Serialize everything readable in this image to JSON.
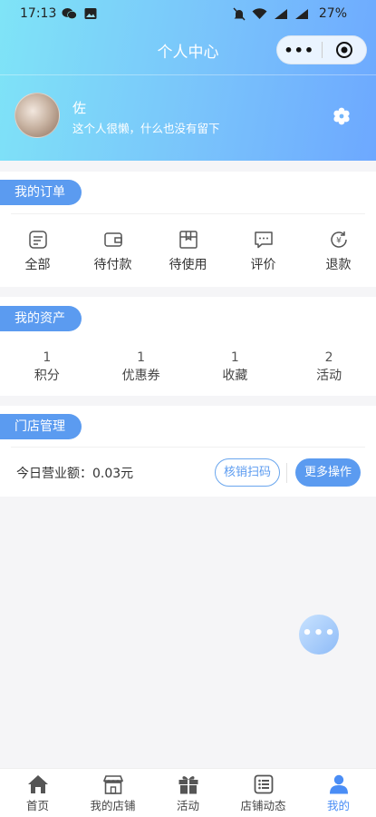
{
  "status_bar": {
    "time": "17:13",
    "battery": "27%"
  },
  "nav": {
    "title": "个人中心"
  },
  "profile": {
    "name": "佐",
    "signature": "这个人很懒，什么也没有留下"
  },
  "orders": {
    "title": "我的订单",
    "items": [
      {
        "label": "全部",
        "icon": "document-icon"
      },
      {
        "label": "待付款",
        "icon": "wallet-icon"
      },
      {
        "label": "待使用",
        "icon": "box-icon"
      },
      {
        "label": "评价",
        "icon": "comment-icon"
      },
      {
        "label": "退款",
        "icon": "refund-icon"
      }
    ]
  },
  "assets": {
    "title": "我的资产",
    "items": [
      {
        "count": "1",
        "label": "积分"
      },
      {
        "count": "1",
        "label": "优惠券"
      },
      {
        "count": "1",
        "label": "收藏"
      },
      {
        "count": "2",
        "label": "活动"
      }
    ]
  },
  "store": {
    "title": "门店管理",
    "today_label": "今日营业额：0.03元",
    "scan_button": "核销扫码",
    "more_button": "更多操作"
  },
  "fab": {
    "icon": "more-dots-icon"
  },
  "tabbar": {
    "items": [
      {
        "label": "首页",
        "icon": "home-icon"
      },
      {
        "label": "我的店铺",
        "icon": "shop-icon"
      },
      {
        "label": "活动",
        "icon": "gift-icon"
      },
      {
        "label": "店铺动态",
        "icon": "list-icon"
      },
      {
        "label": "我的",
        "icon": "user-icon"
      }
    ],
    "active_index": 4
  },
  "colors": {
    "accent": "#5b9bf0",
    "active_tab": "#4a8df5",
    "header_start": "#7fe4f7",
    "header_end": "#6da8ff"
  }
}
